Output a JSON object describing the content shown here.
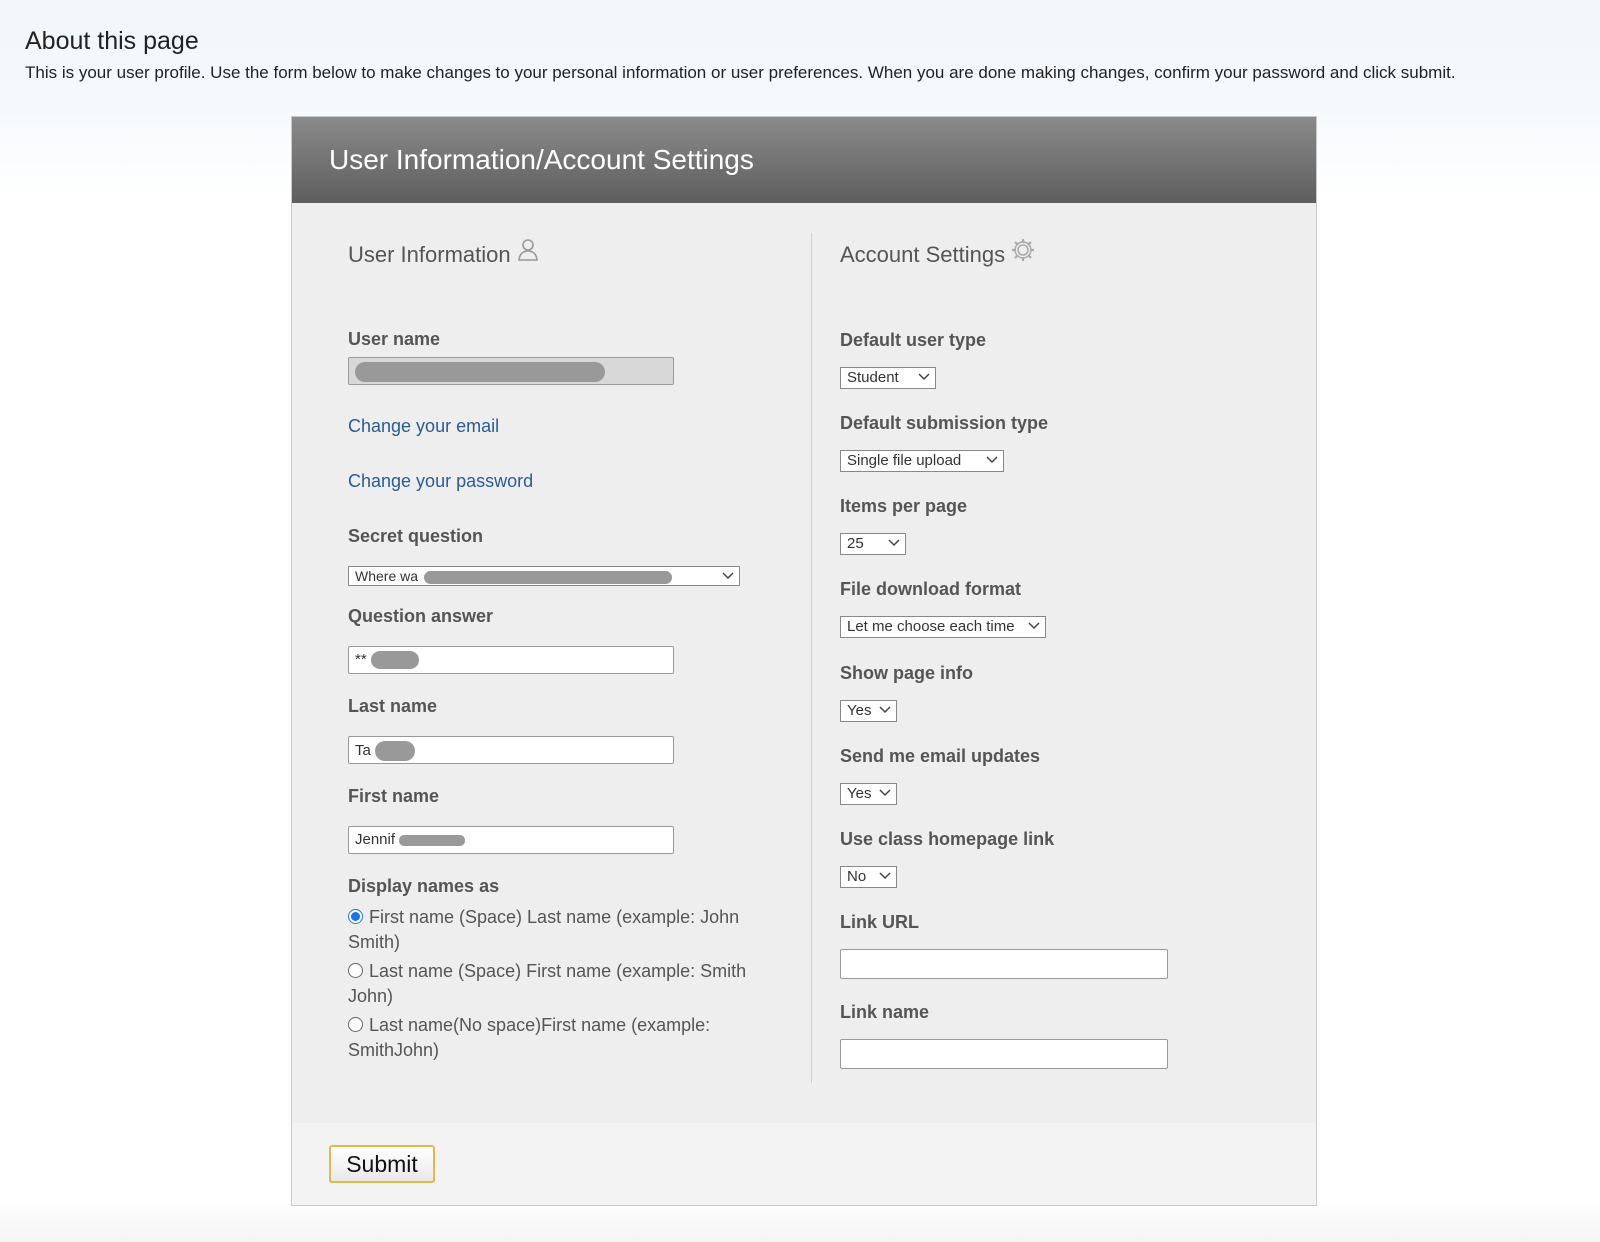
{
  "about": {
    "title": "About this page",
    "description": "This is your user profile. Use the form below to make changes to your personal information or user preferences. When you are done making changes, confirm your password and click submit."
  },
  "panel": {
    "title": "User Information/Account Settings"
  },
  "user_info": {
    "section_title": "User Information",
    "icon": "user-icon",
    "username_label": "User name",
    "change_email_link": "Change your email",
    "change_password_link": "Change your password",
    "secret_question_label": "Secret question",
    "secret_question_value": "Where wa",
    "question_answer_label": "Question answer",
    "question_answer_value": "**",
    "last_name_label": "Last name",
    "last_name_value": "Ta",
    "first_name_label": "First name",
    "first_name_value": "Jennif",
    "display_names_label": "Display names as",
    "display_options": [
      {
        "label": "First name (Space) Last name (example: John Smith)",
        "selected": true
      },
      {
        "label": "Last name (Space) First name (example: Smith John)",
        "selected": false
      },
      {
        "label": "Last name(No space)First name (example: SmithJohn)",
        "selected": false
      }
    ]
  },
  "account_settings": {
    "section_title": "Account Settings",
    "icon": "gear-icon",
    "default_user_type_label": "Default user type",
    "default_user_type_value": "Student",
    "default_submission_type_label": "Default submission type",
    "default_submission_type_value": "Single file upload",
    "items_per_page_label": "Items per page",
    "items_per_page_value": "25",
    "file_download_format_label": "File download format",
    "file_download_format_value": "Let me choose each time",
    "show_page_info_label": "Show page info",
    "show_page_info_value": "Yes",
    "email_updates_label": "Send me email updates",
    "email_updates_value": "Yes",
    "class_homepage_label": "Use class homepage link",
    "class_homepage_value": "No",
    "link_url_label": "Link URL",
    "link_url_value": "",
    "link_name_label": "Link name",
    "link_name_value": ""
  },
  "footer": {
    "submit_label": "Submit"
  },
  "colors": {
    "link": "#2a5b96",
    "header_gradient_top": "#8a8a8a",
    "header_gradient_bottom": "#5e5e5e",
    "submit_border": "#e0b94a",
    "radio_selected": "#1a73e8"
  }
}
